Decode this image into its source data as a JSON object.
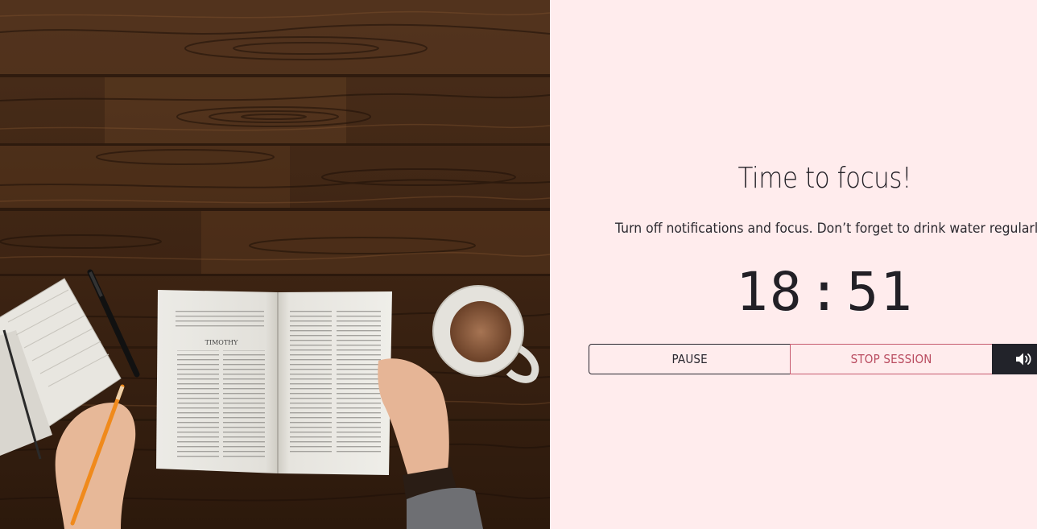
{
  "focus": {
    "title": "Time to focus!",
    "message": "Turn off notifications and focus. Don’t forget to drink water regularly.",
    "timer": {
      "minutes": "18",
      "separator": ":",
      "seconds": "51"
    }
  },
  "controls": {
    "pause_label": "PAUSE",
    "stop_label": "STOP SESSION",
    "sound_icon": "volume-up-icon"
  },
  "photo": {
    "book_heading": "TIMOTHY",
    "subject": "desk-with-open-book-coffee-notebook"
  },
  "colors": {
    "panel_background": "#ffeced",
    "text": "#222026",
    "stop_accent": "#b94b5f",
    "sound_button": "#22232a"
  }
}
